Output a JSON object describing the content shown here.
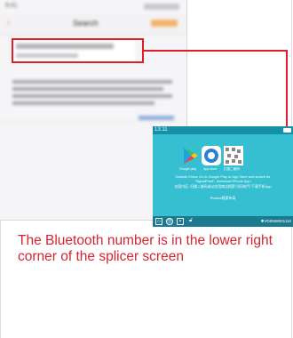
{
  "phone": {
    "status_time": "9:41",
    "nav_title": "Search",
    "back_label": "‹"
  },
  "splicer": {
    "time": "13:11",
    "apps": [
      {
        "label": "Google play"
      },
      {
        "label": "App store"
      },
      {
        "label": "扫描二维码"
      }
    ],
    "text_line1": "Outside China: Go to Google Play or App Store and search for",
    "text_line2": "\"SignalFire8\", download iPhone App;",
    "text_line3": "在国内区: 扫描二维码或从应用商店搜索\"讯风电气\"下载手机App",
    "text_line4": "Pinduo/搜索布局",
    "bluetooth_id": "✱VD8558001110"
  },
  "caption": "The Bluetooth number is in the lower right corner of the splicer screen",
  "colors": {
    "accent_red": "#e11d2a",
    "splicer_bg": "#36bfd0",
    "caption_red": "#d42430"
  }
}
